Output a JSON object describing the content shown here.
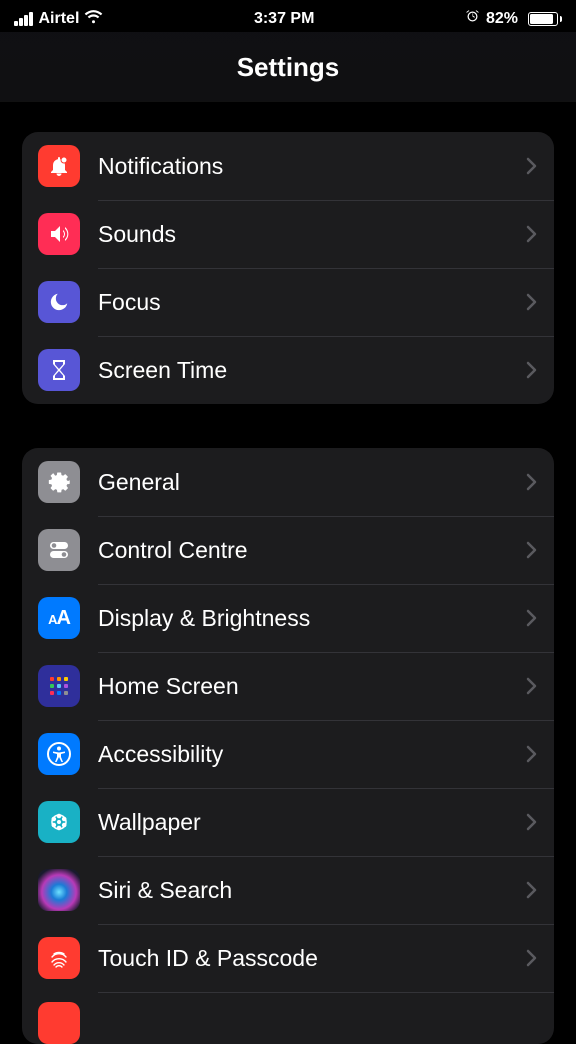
{
  "status": {
    "carrier": "Airtel",
    "time": "3:37 PM",
    "battery": "82%"
  },
  "header": {
    "title": "Settings"
  },
  "groups": [
    {
      "items": [
        {
          "icon": "bell",
          "iconBg": "#ff3b30",
          "label": "Notifications"
        },
        {
          "icon": "speaker",
          "iconBg": "#ff2d55",
          "label": "Sounds"
        },
        {
          "icon": "moon",
          "iconBg": "#5856d6",
          "label": "Focus"
        },
        {
          "icon": "hourglass",
          "iconBg": "#5856d6",
          "label": "Screen Time"
        }
      ]
    },
    {
      "items": [
        {
          "icon": "gear",
          "iconBg": "#8e8e93",
          "label": "General"
        },
        {
          "icon": "toggles",
          "iconBg": "#8e8e93",
          "label": "Control Centre"
        },
        {
          "icon": "aa",
          "iconBg": "#007aff",
          "label": "Display & Brightness"
        },
        {
          "icon": "homescreen",
          "iconBg": "#2f2f9b",
          "label": "Home Screen"
        },
        {
          "icon": "accessibility",
          "iconBg": "#007aff",
          "label": "Accessibility"
        },
        {
          "icon": "wallpaper",
          "iconBg": "#19b1c5",
          "label": "Wallpaper"
        },
        {
          "icon": "siri",
          "iconBg": "#1c1c1e",
          "label": "Siri & Search"
        },
        {
          "icon": "fingerprint",
          "iconBg": "#ff3b30",
          "label": "Touch ID & Passcode"
        },
        {
          "icon": "sos",
          "iconBg": "#ff3b30",
          "label": ""
        }
      ]
    }
  ]
}
